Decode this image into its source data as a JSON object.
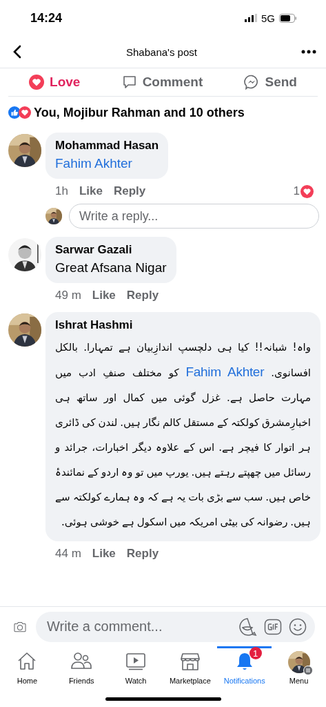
{
  "status_bar": {
    "time": "14:24",
    "network": "5G"
  },
  "header": {
    "title": "Shabana's post"
  },
  "actions": [
    {
      "label": "Love",
      "kind": "love",
      "selected": true
    },
    {
      "label": "Comment",
      "kind": "comment",
      "selected": false
    },
    {
      "label": "Send",
      "kind": "send",
      "selected": false
    }
  ],
  "reactions": {
    "text": "You, Mojibur Rahman and 10 others"
  },
  "comments": [
    {
      "author": "Mohammad Hasan",
      "body": [
        {
          "kind": "mention",
          "text": "Fahim Akhter"
        }
      ],
      "time": "1h",
      "like": "Like",
      "reply": "Reply",
      "reaction_count": "1",
      "reply_box": {
        "placeholder": "Write a reply..."
      }
    },
    {
      "author": "Sarwar Gazali",
      "body": [
        {
          "kind": "text",
          "text": "Great Afsana Nigar"
        }
      ],
      "time": "49 m",
      "like": "Like",
      "reply": "Reply"
    },
    {
      "author": "Ishrat Hashmi",
      "body": [
        {
          "kind": "text",
          "text": "واہ! شبانہ!! کیا ہی دلچسپ اندازِبیان ہے تمہارا. بالکل افسانوی. "
        },
        {
          "kind": "mention",
          "text": "Fahim Akhter"
        },
        {
          "kind": "text",
          "text": " کو مختلف صنفِ ادب میں مہارت حاصل ہے. غزل گوئی میں کمال اور ساتھ ہی اخبارِمشرق کولکتہ کے مستقل کالم نگار ہیں. لندن کی ڈائری ہر اتوار کا فیچر ہے. اس کے علاوہ دیگر اخبارات، جرائد و رسائل میں چھپتے رہتے ہیں. یورپ میں تو وہ اردو کے نمائندۂ خاص ہیں. سب سے بڑی بات یہ ہے کہ وہ ہمارے کولکتہ سے ہیں. رضوانہ کی بیٹی امریکہ میں اسکول ہے خوشی ہوئی."
        }
      ],
      "time": "44 m",
      "like": "Like",
      "reply": "Reply"
    }
  ],
  "composer": {
    "placeholder": "Write a comment..."
  },
  "tabs": [
    {
      "label": "Home",
      "kind": "home",
      "selected": false
    },
    {
      "label": "Friends",
      "kind": "friends",
      "selected": false
    },
    {
      "label": "Watch",
      "kind": "watch",
      "selected": false
    },
    {
      "label": "Marketplace",
      "kind": "marketplace",
      "selected": false
    },
    {
      "label": "Notifications",
      "kind": "notifications",
      "selected": true,
      "badge": "1"
    },
    {
      "label": "Menu",
      "kind": "menu",
      "selected": false
    }
  ]
}
